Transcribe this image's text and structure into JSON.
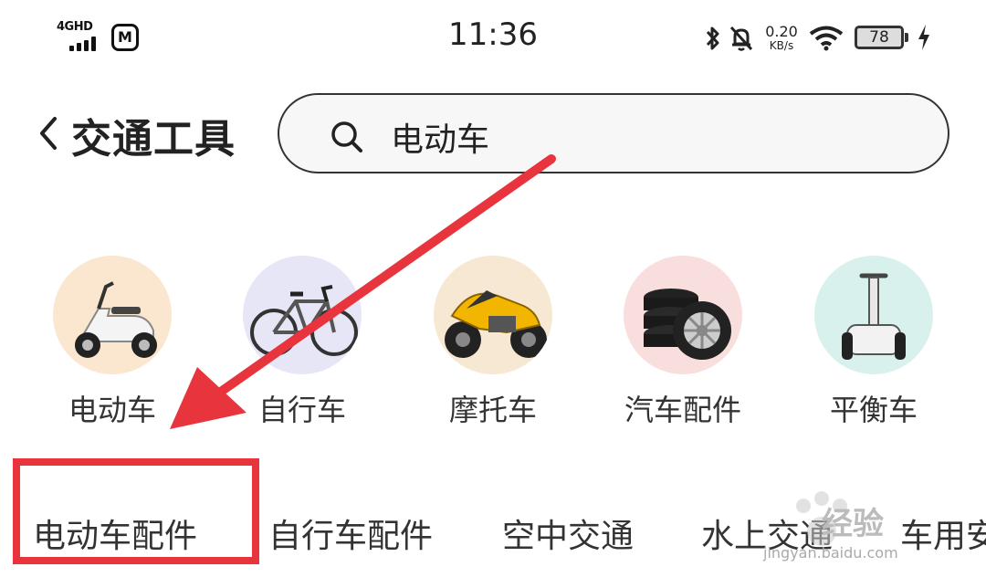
{
  "status_bar": {
    "network": "4GHD",
    "app_icon": "M",
    "time": "11:36",
    "net_rate_value": "0.20",
    "net_rate_unit": "KB/s",
    "battery": "78"
  },
  "header": {
    "title": "交通工具",
    "search_value": "电动车"
  },
  "categories": [
    {
      "label": "电动车",
      "icon": "e-scooter-image",
      "bg": "#fbe6cf"
    },
    {
      "label": "自行车",
      "icon": "bicycle-image",
      "bg": "#e6e6f6"
    },
    {
      "label": "摩托车",
      "icon": "motorcycle-image",
      "bg": "#f7e8d4"
    },
    {
      "label": "汽车配件",
      "icon": "tires-image",
      "bg": "#f9dede"
    },
    {
      "label": "平衡车",
      "icon": "balance-scooter-image",
      "bg": "#d9f1ec"
    }
  ],
  "subtabs": [
    "电动车配件",
    "自行车配件",
    "空中交通",
    "水上交通",
    "车用安"
  ],
  "watermark": {
    "text": "经验",
    "url": "jingyan.baidu.com"
  },
  "colors": {
    "annotation_red": "#e8343c"
  }
}
